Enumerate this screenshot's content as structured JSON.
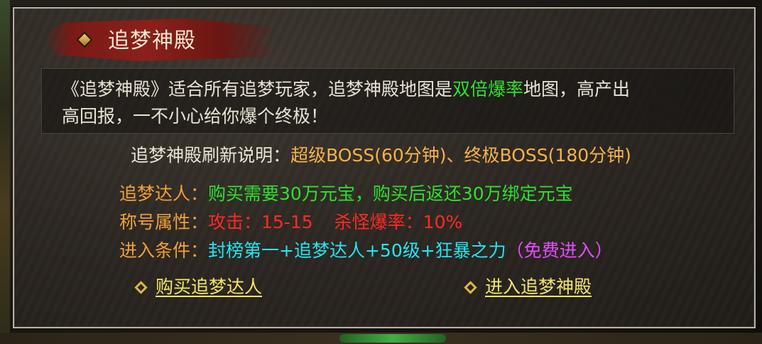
{
  "title": "追梦神殿",
  "description": {
    "part1": "《追梦神殿》适合所有追梦玩家，追梦神殿地图是",
    "highlight": "双倍爆率",
    "part2": "地图，高产出",
    "line2": "高回报，一不小心给你爆个终极！"
  },
  "refresh": {
    "label": "追梦神殿刷新说明：",
    "value": "超级BOSS(60分钟)、终极BOSS(180分钟)"
  },
  "rows": [
    {
      "key": "追梦达人：",
      "value": "购买需要30万元宝，购买后返还30万绑定元宝"
    },
    {
      "key": "称号属性：",
      "value1": "攻击：15-15",
      "value2": "杀怪爆率：10%"
    },
    {
      "key": "进入条件：",
      "value": "封榜第一+追梦达人+50级+狂暴之力",
      "note": "（免费进入）"
    }
  ],
  "actions": {
    "buy": "购买追梦达人",
    "enter": "进入追梦神殿"
  },
  "colors": {
    "key": "#f0a13a",
    "green": "#2fe02f",
    "red": "#ff2a22",
    "cyan": "#24e6f2",
    "magenta": "#e34dff",
    "link": "#f4e56a"
  }
}
